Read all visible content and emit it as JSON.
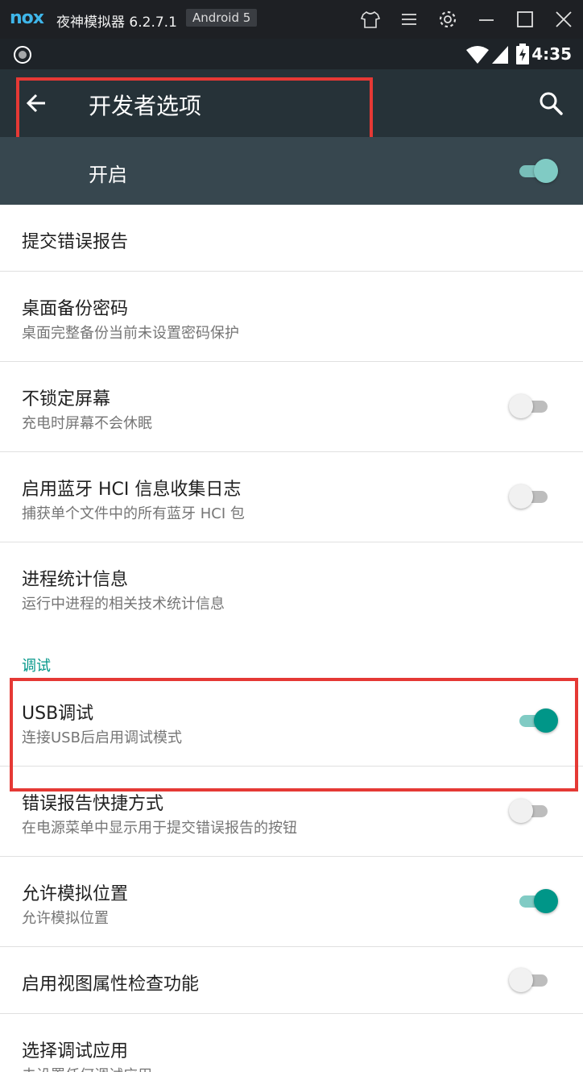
{
  "emulator": {
    "logo": "nox",
    "title": "夜神模拟器 6.2.7.1",
    "badge": "Android 5",
    "icons": [
      "shirt-icon",
      "menu-icon",
      "gear-icon",
      "minimize-icon",
      "maximize-icon",
      "close-icon"
    ]
  },
  "status_bar": {
    "time": "4:35",
    "icons": [
      "nox-notification-icon",
      "wifi-icon",
      "signal-icon",
      "battery-charging-icon"
    ]
  },
  "action_bar": {
    "title": "开发者选项",
    "back_icon": "arrow-back-icon",
    "search_icon": "search-icon"
  },
  "master": {
    "label": "开启",
    "enabled": true
  },
  "settings": [
    {
      "title": "提交错误报告",
      "subtitle": "",
      "toggle": null
    },
    {
      "title": "桌面备份密码",
      "subtitle": "桌面完整备份当前未设置密码保护",
      "toggle": null
    },
    {
      "title": "不锁定屏幕",
      "subtitle": "充电时屏幕不会休眠",
      "toggle": false
    },
    {
      "title": "启用蓝牙 HCI 信息收集日志",
      "subtitle": "捕获单个文件中的所有蓝牙 HCI 包",
      "toggle": false
    },
    {
      "title": "进程统计信息",
      "subtitle": "运行中进程的相关技术统计信息",
      "toggle": null
    }
  ],
  "debug_section": {
    "header": "调试",
    "items": [
      {
        "title": "USB调试",
        "subtitle": "连接USB后启用调试模式",
        "toggle": true
      },
      {
        "title": "错误报告快捷方式",
        "subtitle": "在电源菜单中显示用于提交错误报告的按钮",
        "toggle": false
      },
      {
        "title": "允许模拟位置",
        "subtitle": "允许模拟位置",
        "toggle": true
      },
      {
        "title": "启用视图属性检查功能",
        "subtitle": "",
        "toggle": false
      },
      {
        "title": "选择调试应用",
        "subtitle": "未设置任何调试应用",
        "toggle": null
      }
    ]
  },
  "colors": {
    "accent": "#009688",
    "highlight": "#e53935",
    "action_bar": "#263238",
    "master_bar": "#37474f"
  }
}
